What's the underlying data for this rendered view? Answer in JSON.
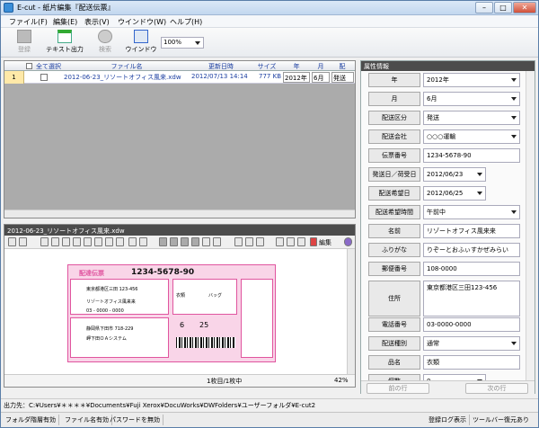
{
  "window": {
    "title": "E-cut - 紙片編集『配送伝票』",
    "min": "–",
    "max": "□",
    "close": "✕"
  },
  "menu": [
    "ファイル(F)",
    "編集(E)",
    "表示(V)",
    "ウインドウ(W)",
    "ヘルプ(H)"
  ],
  "toolbar": {
    "register": "登録",
    "text_export": "テキスト出力",
    "search": "検索",
    "window": "ウインドウ",
    "zoom": "100%"
  },
  "grid": {
    "headers": [
      "全て選択",
      "ファイル名",
      "更新日時",
      "サイズ",
      "年",
      "月",
      "配"
    ],
    "row": {
      "num": "1",
      "filename": "2012-06-23_リソートオフィス風来.xdw",
      "updated": "2012/07/13 14:14",
      "size": "777 KB",
      "year": "2012年",
      "month": "6月",
      "ship": "発送"
    }
  },
  "preview": {
    "title": "2012-06-23_リソートオフィス風来.xdw",
    "edit_label": "編集",
    "page_info": "1枚目/1枚中",
    "zoom": "42%",
    "slip": {
      "header": "配達伝票",
      "tracking": "1234-5678-90",
      "address_to": "東京都港区三田 123-456",
      "name_to": "リゾートオフィス風来来",
      "phone": "03 - 0000 - 0000",
      "address_from": "静岡県下田市 718-229",
      "name_from": "岬下田ＯＡシステム",
      "item1": "衣類",
      "item2": "バッグ",
      "date_m": "6",
      "date_d": "25"
    }
  },
  "attributes": {
    "title": "属性情報",
    "fields": [
      {
        "label": "年",
        "value": "2012年",
        "dropdown": true
      },
      {
        "label": "月",
        "value": "6月",
        "dropdown": true
      },
      {
        "label": "配送区分",
        "value": "発送",
        "dropdown": true
      },
      {
        "label": "配送会社",
        "value": "○○○運輸",
        "dropdown": true
      },
      {
        "label": "伝票番号",
        "value": "1234-5678-90",
        "dropdown": false
      },
      {
        "label": "発送日／荷受日",
        "value": "2012/06/23",
        "dropdown": true
      },
      {
        "label": "配送希望日",
        "value": "2012/06/25",
        "dropdown": true
      },
      {
        "label": "配送希望時間",
        "value": "午前中",
        "dropdown": true
      },
      {
        "label": "名前",
        "value": "リゾートオフィス風来来",
        "dropdown": false
      },
      {
        "label": "ふりがな",
        "value": "りぞーとおふぃすかぜみらい",
        "dropdown": false
      },
      {
        "label": "郵便番号",
        "value": "108-0000",
        "dropdown": false
      },
      {
        "label": "住所",
        "value": "東京都港区三田123-456",
        "dropdown": false
      },
      {
        "label": "電話番号",
        "value": "03-0000-0000",
        "dropdown": false
      },
      {
        "label": "配送種別",
        "value": "通常",
        "dropdown": true
      },
      {
        "label": "品名",
        "value": "衣類",
        "dropdown": false
      },
      {
        "label": "個数",
        "value": "0",
        "dropdown": true
      }
    ],
    "prev": "前の行",
    "next": "次の行"
  },
  "path": "出力先：C:¥Users¥＊＊＊＊¥Documents¥Fuji Xerox¥DocuWorks¥DWFolders¥ユーザーフォルダ¥E-cut2",
  "status": {
    "folder_watch": "フォルダ階層有効",
    "filename_on": "ファイル名有効",
    "password_off": "パスワードを無効",
    "log": "登録ログ表示",
    "toolbar_restore": "ツールバー復元あり"
  }
}
